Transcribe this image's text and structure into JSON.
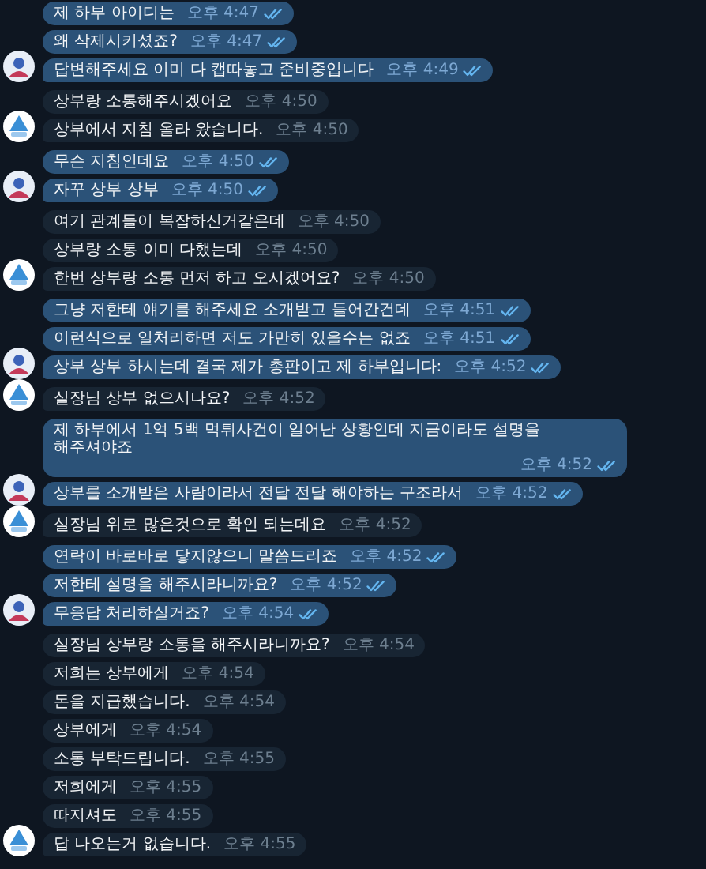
{
  "messages": [
    {
      "kind": "outgoing",
      "text": "제 하부 아이디는",
      "time": "오후 4:47",
      "read": true,
      "avatar": false
    },
    {
      "kind": "outgoing",
      "text": "왜 삭제시키셨죠?",
      "time": "오후 4:47",
      "read": true,
      "avatar": false
    },
    {
      "kind": "outgoing",
      "text": "답변해주세요 이미 다 캡따놓고 준비중입니다",
      "time": "오후 4:49",
      "read": true,
      "avatar": true
    },
    {
      "kind": "incoming",
      "text": "상부랑 소통해주시겠어요",
      "time": "오후 4:50",
      "read": false,
      "avatar": false
    },
    {
      "kind": "incoming",
      "text": "상부에서 지침 올라 왔습니다.",
      "time": "오후 4:50",
      "read": false,
      "avatar": true
    },
    {
      "kind": "outgoing",
      "text": "무슨 지침인데요",
      "time": "오후 4:50",
      "read": true,
      "avatar": false
    },
    {
      "kind": "outgoing",
      "text": "자꾸 상부 상부",
      "time": "오후 4:50",
      "read": true,
      "avatar": true
    },
    {
      "kind": "incoming",
      "text": "여기 관계들이 복잡하신거같은데",
      "time": "오후 4:50",
      "read": false,
      "avatar": false
    },
    {
      "kind": "incoming",
      "text": "상부랑 소통 이미 다했는데",
      "time": "오후 4:50",
      "read": false,
      "avatar": false
    },
    {
      "kind": "incoming",
      "text": "한번 상부랑 소통 먼저 하고 오시겠어요?",
      "time": "오후 4:50",
      "read": false,
      "avatar": true
    },
    {
      "kind": "outgoing",
      "text": "그냥 저한테 얘기를 해주세요 소개받고 들어간건데",
      "time": "오후 4:51",
      "read": true,
      "avatar": false
    },
    {
      "kind": "outgoing",
      "text": "이런식으로 일처리하면 저도 가만히 있을수는 없죠",
      "time": "오후 4:51",
      "read": true,
      "avatar": false
    },
    {
      "kind": "outgoing",
      "text": "상부 상부 하시는데 결국 제가 총판이고 제 하부입니다:",
      "time": "오후 4:52",
      "read": true,
      "avatar": true
    },
    {
      "kind": "incoming",
      "text": "실장님 상부 없으시나요?",
      "time": "오후 4:52",
      "read": false,
      "avatar": true
    },
    {
      "kind": "outgoing",
      "text": "제 하부에서 1억 5백 먹튀사건이 일어난 상황인데 지금이라도 설명을 해주셔야죠",
      "time": "오후 4:52",
      "read": true,
      "avatar": false
    },
    {
      "kind": "outgoing",
      "text": "상부를 소개받은 사람이라서 전달 전달 해야하는 구조라서",
      "time": "오후 4:52",
      "read": true,
      "avatar": true
    },
    {
      "kind": "incoming",
      "text": "실장님 위로 많은것으로 확인 되는데요",
      "time": "오후 4:52",
      "read": false,
      "avatar": true
    },
    {
      "kind": "outgoing",
      "text": "연락이 바로바로 닿지않으니 말씀드리죠",
      "time": "오후 4:52",
      "read": true,
      "avatar": false
    },
    {
      "kind": "outgoing",
      "text": "저한테 설명을 해주시라니까요?",
      "time": "오후 4:52",
      "read": true,
      "avatar": false
    },
    {
      "kind": "outgoing",
      "text": "무응답 처리하실거죠?",
      "time": "오후 4:54",
      "read": true,
      "avatar": true
    },
    {
      "kind": "incoming",
      "text": "실장님 상부랑 소통을 해주시라니까요?",
      "time": "오후 4:54",
      "read": false,
      "avatar": false
    },
    {
      "kind": "incoming",
      "text": "저희는 상부에게",
      "time": "오후 4:54",
      "read": false,
      "avatar": false
    },
    {
      "kind": "incoming",
      "text": "돈을 지급했습니다.",
      "time": "오후 4:54",
      "read": false,
      "avatar": false
    },
    {
      "kind": "incoming",
      "text": "상부에게",
      "time": "오후 4:54",
      "read": false,
      "avatar": false
    },
    {
      "kind": "incoming",
      "text": "소통 부탁드립니다.",
      "time": "오후 4:55",
      "read": false,
      "avatar": false
    },
    {
      "kind": "incoming",
      "text": "저희에게",
      "time": "오후 4:55",
      "read": false,
      "avatar": false
    },
    {
      "kind": "incoming",
      "text": "따지셔도",
      "time": "오후 4:55",
      "read": false,
      "avatar": false
    },
    {
      "kind": "incoming",
      "text": "답 나오는거 없습니다.",
      "time": "오후 4:55",
      "read": false,
      "avatar": true
    }
  ]
}
